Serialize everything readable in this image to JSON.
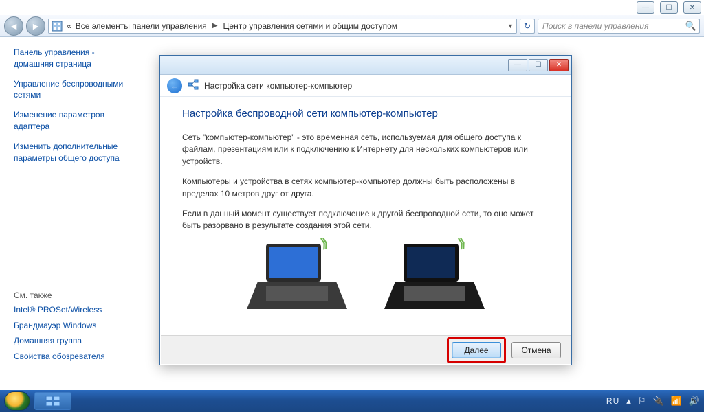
{
  "window_buttons": {
    "min": "—",
    "max": "☐",
    "close": "✕"
  },
  "explorer": {
    "nav_back": "◄",
    "nav_fwd": "►",
    "crumb_prefix": "«",
    "crumb1": "Все элементы панели управления",
    "crumb2": "Центр управления сетями и общим доступом",
    "search_placeholder": "Поиск в панели управления"
  },
  "sidebar": {
    "home1": "Панель управления -",
    "home2": "домашняя страница",
    "link1a": "Управление беспроводными",
    "link1b": "сетями",
    "link2a": "Изменение параметров",
    "link2b": "адаптера",
    "link3a": "Изменить дополнительные",
    "link3b": "параметры общего доступа",
    "see_also": "См. также",
    "sa1": "Intel® PROSet/Wireless",
    "sa2": "Брандмауэр Windows",
    "sa3": "Домашняя группа",
    "sa4": "Свойства обозревателя"
  },
  "dialog": {
    "title": "Настройка сети компьютер-компьютер",
    "heading": "Настройка беспроводной сети компьютер-компьютер",
    "p1": "Сеть \"компьютер-компьютер\" - это временная сеть, используемая для общего доступа к файлам, презентациям или к подключению к Интернету для нескольких компьютеров или устройств.",
    "p2": "Компьютеры и устройства в сетях компьютер-компьютер должны быть расположены в пределах 10 метров друг от друга.",
    "p3": "Если в данный момент существует подключение к другой беспроводной сети, то оно может быть разорвано в результате создания этой сети.",
    "next": "Далее",
    "cancel": "Отмена"
  },
  "taskbar": {
    "lang": "RU"
  }
}
